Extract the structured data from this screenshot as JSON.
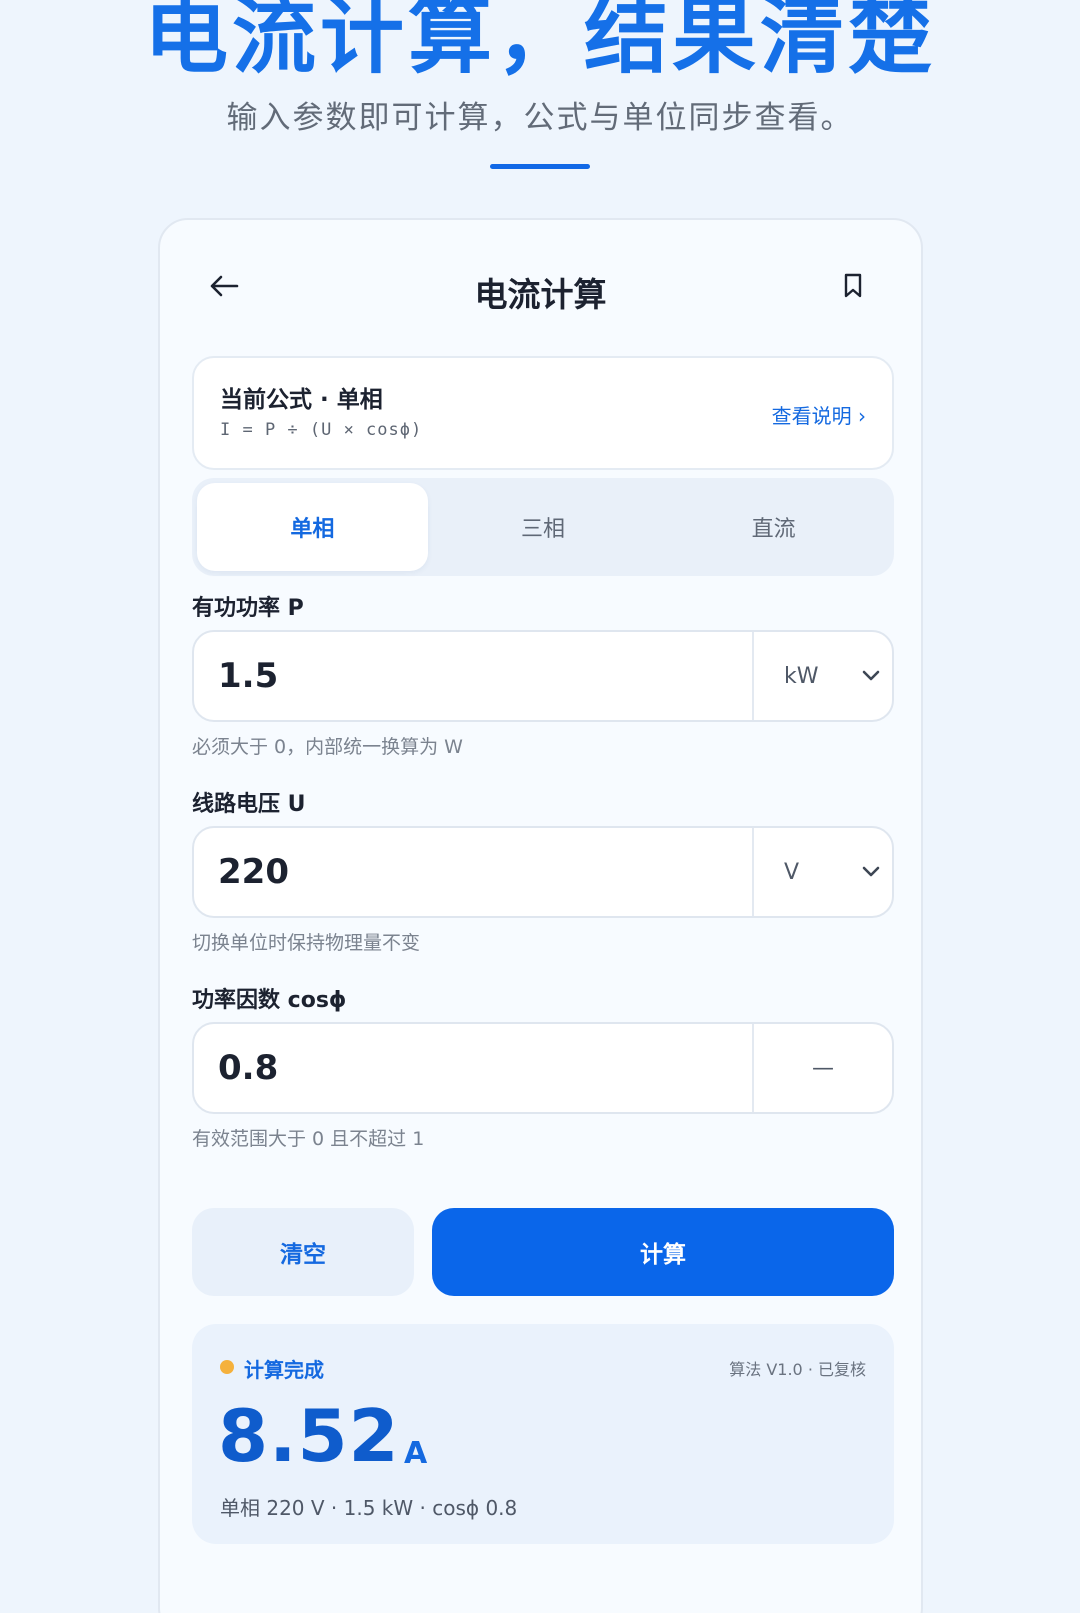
{
  "hero": {
    "title": "电流计算，结果清楚",
    "subtitle": "输入参数即可计算，公式与单位同步查看。"
  },
  "header": {
    "title": "电流计算",
    "back_icon": "arrow-left-icon",
    "bookmark_icon": "bookmark-icon"
  },
  "formula": {
    "title": "当前公式 · 单相",
    "expression": "I = P ÷ (U × cosϕ)",
    "link": "查看说明 ›"
  },
  "tabs": [
    {
      "label": "单相",
      "active": true
    },
    {
      "label": "三相",
      "active": false
    },
    {
      "label": "直流",
      "active": false
    }
  ],
  "fields": {
    "power": {
      "label": "有功功率 P",
      "value": "1.5",
      "unit": "kW",
      "hint": "必须大于 0，内部统一换算为 W"
    },
    "voltage": {
      "label": "线路电压 U",
      "value": "220",
      "unit": "V",
      "hint": "切换单位时保持物理量不变"
    },
    "pf": {
      "label": "功率因数 cosϕ",
      "value": "0.8",
      "unit": "—",
      "hint": "有效范围大于 0 且不超过 1"
    }
  },
  "actions": {
    "clear": "清空",
    "calculate": "计算"
  },
  "result": {
    "status": "计算完成",
    "meta": "算法 V1.0 · 已复核",
    "value": "8.52",
    "unit": "A",
    "summary": "单相 220 V · 1.5 kW · cosϕ 0.8"
  },
  "colors": {
    "accent": "#0a66ea",
    "status_dot": "#f5b13c",
    "background": "#eef5fd"
  }
}
